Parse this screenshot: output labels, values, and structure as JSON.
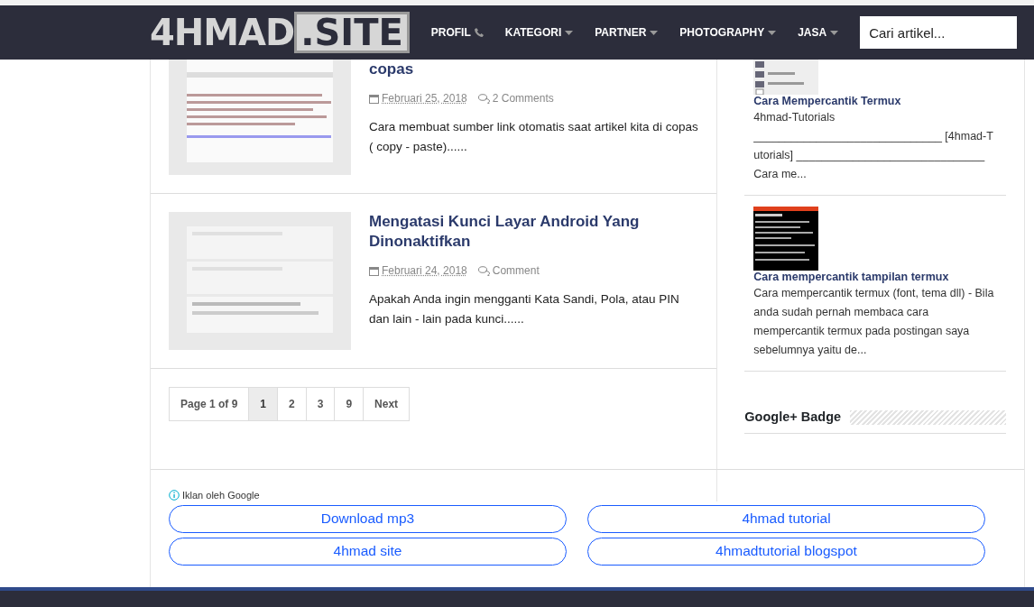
{
  "header": {
    "logo": {
      "part_1": "4HMAD",
      "part_2": ".SITE"
    },
    "nav": [
      {
        "label": "PROFIL",
        "kind": "phone"
      },
      {
        "label": "KATEGORI",
        "kind": "dropdown"
      },
      {
        "label": "PARTNER",
        "kind": "dropdown"
      },
      {
        "label": "PHOTOGRAPHY",
        "kind": "dropdown"
      },
      {
        "label": "JASA",
        "kind": "dropdown"
      }
    ],
    "search": {
      "placeholder": "Cari artikel..."
    }
  },
  "posts": [
    {
      "title": "copas",
      "date": "Februari 25, 2018",
      "comments": "2 Comments",
      "excerpt": "Cara membuat sumber link otomatis saat artikel kita di copas ( copy - paste)......"
    },
    {
      "title": "Mengatasi Kunci Layar Android Yang Dinonaktifkan",
      "date": "Februari 24, 2018",
      "comments": "Comment",
      "excerpt": "Apakah Anda ingin mengganti Kata Sandi, Pola, atau PIN dan lain - lain pada kunci......"
    }
  ],
  "pagination": {
    "summary": "Page 1 of 9",
    "pages": [
      {
        "label": "1",
        "selected": true
      },
      {
        "label": "2",
        "selected": false
      },
      {
        "label": "3",
        "selected": false
      },
      {
        "label": "9",
        "selected": false
      },
      {
        "label": "Next",
        "selected": false
      }
    ]
  },
  "sidebar": {
    "posts": [
      {
        "title": "Cara Mempercantik Termux",
        "excerpt": "4hmad-Tutorials ______________________________ [4hmad-T utorials] ______________________________ Cara me..."
      },
      {
        "title": "Cara mempercantik tampilan termux",
        "excerpt": "Cara mempercantik termux (font, tema dll) - Bila anda sudah pernah membaca cara mempercantik termux pada postingan saya sebelumnya yaitu de..."
      }
    ],
    "widget_title": "Google+ Badge"
  },
  "ads": {
    "label": "Iklan oleh Google",
    "links": [
      "Download mp3",
      "4hmad tutorial",
      "4hmad site",
      "4hmadtutorial blogspot"
    ]
  }
}
